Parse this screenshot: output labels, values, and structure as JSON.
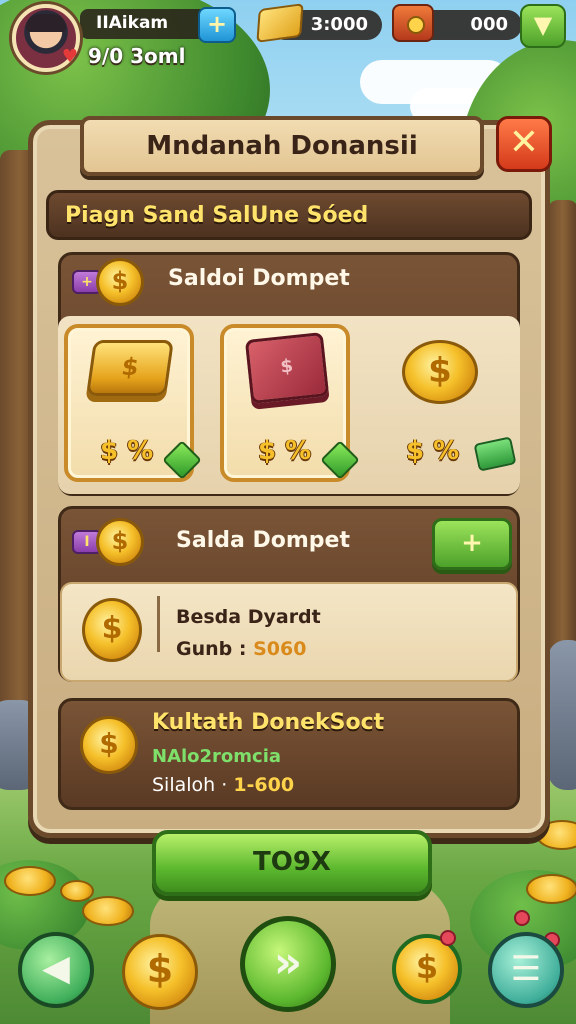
{
  "hud": {
    "player_name": "IIAikam",
    "player_sub": "9/0 3oml",
    "plus_label": "+",
    "gold_amount": "3:000",
    "gem_amount": "000",
    "down_label": "▼"
  },
  "panel": {
    "title": "Mndanah Donansii",
    "close_label": "✕",
    "subtitle": "Piagn Sand  SalUne Sóed",
    "balance": {
      "title": "Saldoi Dompet",
      "tag_label": "+",
      "items": [
        {
          "price_label": "$ %",
          "kind": "gold-bar",
          "badge": "gem"
        },
        {
          "price_label": "$ %",
          "kind": "red-box",
          "badge": "gem"
        },
        {
          "price_label": "$ %",
          "kind": "coin",
          "badge": "cash"
        }
      ]
    },
    "wallet": {
      "title": "Salda Dompet",
      "tag_label": "I",
      "add_label": "+",
      "line1": "Besda Dyardt",
      "line2_prefix": "Gunb : ",
      "line2_value": "S060"
    },
    "donation": {
      "title": "Kultath DonekSoct",
      "line1": "NAlo2romcia",
      "line2_prefix": "Silaloh · ",
      "line2_value": "1-600"
    },
    "confirm_label": "TO9X"
  },
  "nav": {
    "back_label": "◀",
    "coin_label": "$",
    "next_label": "»",
    "coin2_label": "$",
    "menu_label": "☰"
  },
  "colors": {
    "panel_bg": "#d9c29a",
    "panel_border": "#6b4a2c",
    "title_text": "#3a2418",
    "accent_yellow": "#ffe36a",
    "confirm_green": "#5cb82e",
    "close_red": "#d43a1a"
  },
  "icons": [
    "player-avatar",
    "gold-bar-icon",
    "treasure-chest-icon",
    "coin-icon",
    "gem-icon",
    "cash-icon",
    "close-icon",
    "back-arrow-icon",
    "next-arrow-icon",
    "menu-icon"
  ]
}
